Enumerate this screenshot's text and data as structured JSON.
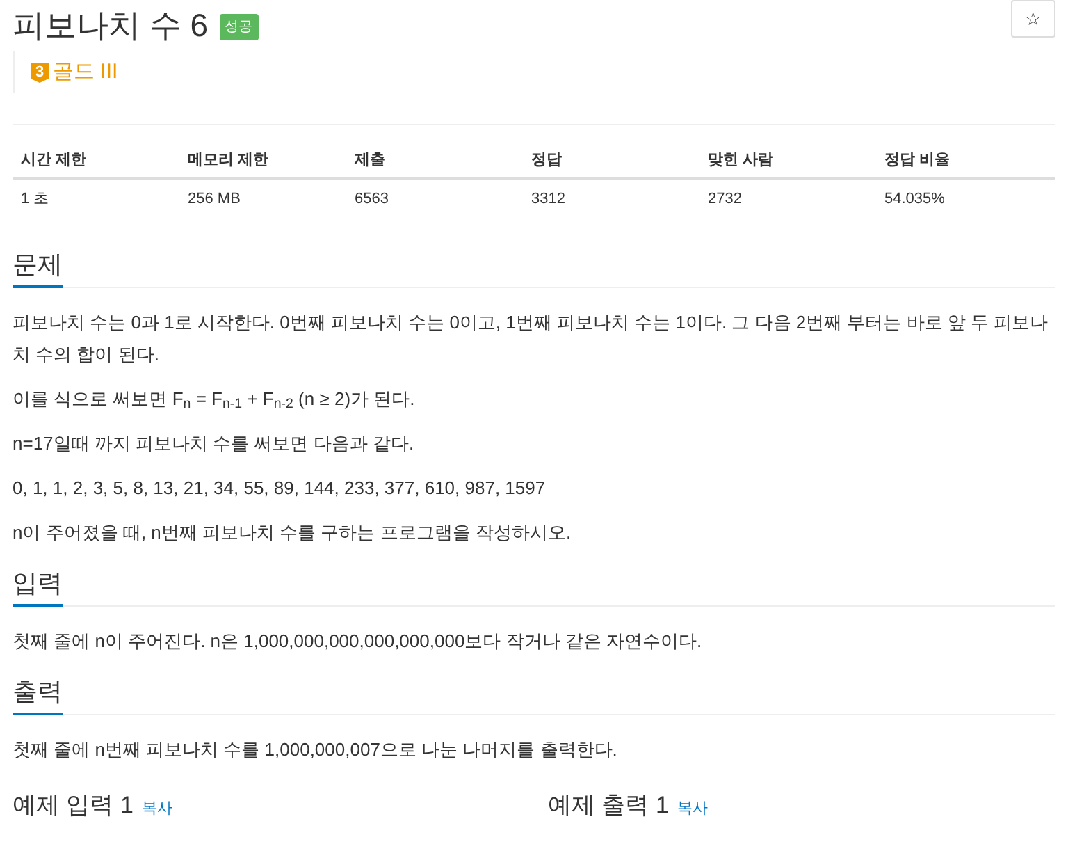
{
  "title": "피보나치 수 6",
  "result_badge": "성공",
  "star_button": "☆",
  "tier": {
    "number": "3",
    "label": "골드 III"
  },
  "stats": {
    "columns": [
      "시간 제한",
      "메모리 제한",
      "제출",
      "정답",
      "맞힌 사람",
      "정답 비율"
    ],
    "row": [
      "1 초",
      "256 MB",
      "6563",
      "3312",
      "2732",
      "54.035%"
    ]
  },
  "sections": [
    {
      "heading": "문제",
      "paragraphs": [
        "피보나치 수는 0과 1로 시작한다. 0번째 피보나치 수는 0이고, 1번째 피보나치 수는 1이다. 그 다음 2번째 부터는 바로 앞 두 피보나치 수의 합이 된다.",
        "이를 식으로 써보면 F$_{n}$ = F$_{n-1}$ + F$_{n-2}$ (n ≥ 2)가 된다.",
        "n=17일때 까지 피보나치 수를 써보면 다음과 같다.",
        "0, 1, 1, 2, 3, 5, 8, 13, 21, 34, 55, 89, 144, 233, 377, 610, 987, 1597",
        "n이 주어졌을 때, n번째 피보나치 수를 구하는 프로그램을 작성하시오."
      ]
    },
    {
      "heading": "입력",
      "paragraphs": [
        "첫째 줄에 n이 주어진다. n은 1,000,000,000,000,000,000보다 작거나 같은 자연수이다."
      ]
    },
    {
      "heading": "출력",
      "paragraphs": [
        "첫째 줄에 n번째 피보나치 수를 1,000,000,007으로 나눈 나머지를 출력한다."
      ]
    }
  ],
  "examples": [
    {
      "heading": "예제 입력 1",
      "copy": "복사"
    },
    {
      "heading": "예제 출력 1",
      "copy": "복사"
    }
  ]
}
